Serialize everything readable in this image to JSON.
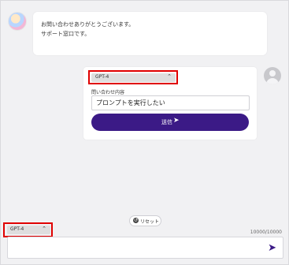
{
  "bot_message": {
    "line1": "お問い合わせありがとうございます。",
    "line2": "サポート窓口です。"
  },
  "user_form": {
    "model_select": "GPT-4",
    "field_label": "問い合わせ内容",
    "field_value": "プロンプトを実行したい",
    "send_label": "送信"
  },
  "reset_label": "リセット",
  "composer": {
    "model_select": "GPT-4",
    "counter": "10000/10000"
  }
}
